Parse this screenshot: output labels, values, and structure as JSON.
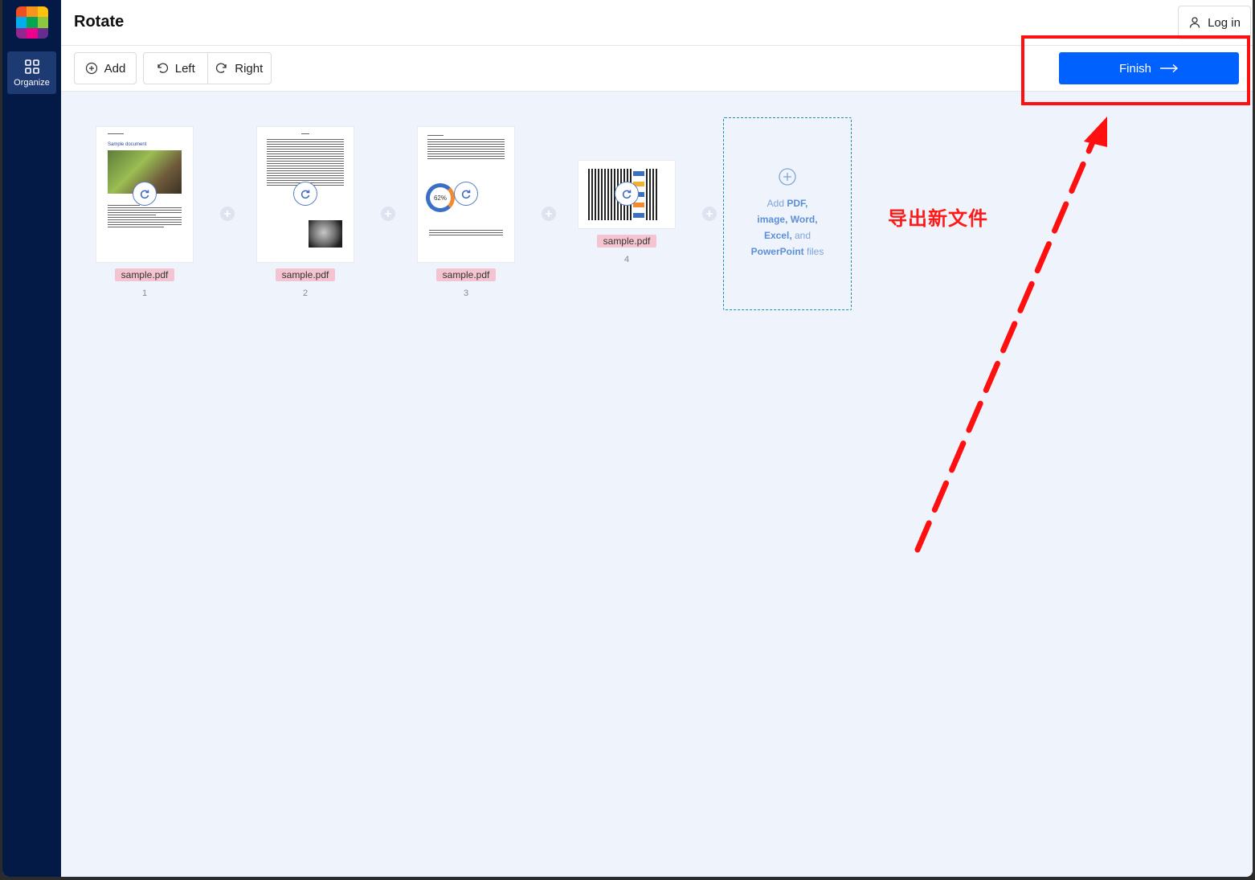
{
  "app": {
    "title": "Rotate",
    "login_label": "Log in"
  },
  "sidebar": {
    "items": [
      {
        "label": "Organize",
        "icon": "grid-icon",
        "active": true
      }
    ],
    "logo_colors": [
      "#f04e23",
      "#f7941d",
      "#ffc20e",
      "#00aeef",
      "#00a651",
      "#8dc63f",
      "#92278f",
      "#ec008c",
      "#662d91"
    ]
  },
  "toolbar": {
    "add_label": "Add",
    "left_label": "Left",
    "right_label": "Right",
    "finish_label": "Finish",
    "finish_color": "#0061fe"
  },
  "pages": [
    {
      "file": "sample.pdf",
      "number": "1"
    },
    {
      "file": "sample.pdf",
      "number": "2"
    },
    {
      "file": "sample.pdf",
      "number": "3"
    },
    {
      "file": "sample.pdf",
      "number": "4"
    }
  ],
  "thumbnails": {
    "page1_heading": "Sample document",
    "page3_chart_label": "62%"
  },
  "dropzone": {
    "add": "Add ",
    "pdf": "PDF,",
    "image": "image,",
    "word": "Word,",
    "excel": "Excel,",
    "and": " and",
    "powerpoint": "PowerPoint",
    "files": " files"
  },
  "annotation": {
    "text": "导出新文件",
    "color": "#ff1010"
  }
}
